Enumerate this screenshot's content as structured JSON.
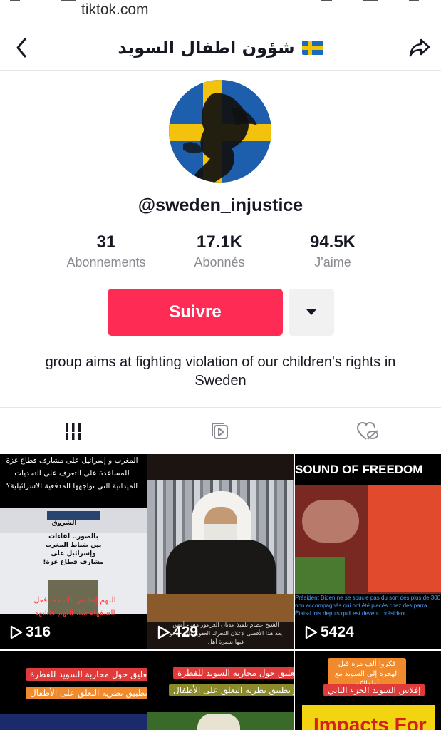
{
  "browser": {
    "url": "tiktok.com"
  },
  "header": {
    "title": "شؤون اطفال السويد",
    "flag": "sweden-flag"
  },
  "profile": {
    "username": "@sweden_injustice",
    "stats": [
      {
        "value": "31",
        "label": "Abonnements"
      },
      {
        "value": "17.1K",
        "label": "Abonnés"
      },
      {
        "value": "94.5K",
        "label": "J'aime"
      }
    ],
    "follow_label": "Suivre",
    "bio": "group aims at fighting violation of our children's rights in Sweden"
  },
  "tabs": [
    {
      "icon": "grid-icon",
      "active": true
    },
    {
      "icon": "reposts-icon",
      "active": false
    },
    {
      "icon": "liked-hidden-icon",
      "active": false
    }
  ],
  "videos": [
    {
      "views": "316",
      "top_text": "المغرب و إسرائيل على مشارف قطاع غزة للمساعدة على التعرف على التحديات الميدانية التي تواجهها المدفعية الاسرائيلية؟",
      "headline": "الشروق",
      "article": "بالصور.. لقاءات بين ضباط المغرب وإسرائيل على مشارف قطاع غزة!",
      "bottom_text": "اللهم إننا نبرأ لك مما فعل السفهاء منا، اللهم فاشهد"
    },
    {
      "views": "429",
      "caption": "الشيخ عصام تلميذ عدنان العرعور مساء أمس بعد هذا الأقصى لإعلان التحرك العقوبة التي يدعو فيها بنصرة أهل"
    },
    {
      "views": "5424",
      "banner": "SOUND OF FREEDOM",
      "subtitle": "Président Biden ne se soucie pas du sort des plus de 300 non accompagnés qui ont été placés chez des parra États-Unis depuis qu'il est devenu président."
    },
    {
      "pill1": "تعليق حول محاربة السويد للفطرة",
      "pill2": "و تطبيق نظرية التعلق على الأطفال"
    },
    {
      "pill1": "تعليق حول محاربة السويد للفطرة",
      "pill2": "و تطبيق نظرية التعلق على الأطفال"
    },
    {
      "pill1": "فكروا ألف مرة قبل الهجرة إلى السويد مع أطفالكم",
      "pill2": "إفلاس السويد الجزء الثاني",
      "banner": "Impacts For"
    }
  ]
}
